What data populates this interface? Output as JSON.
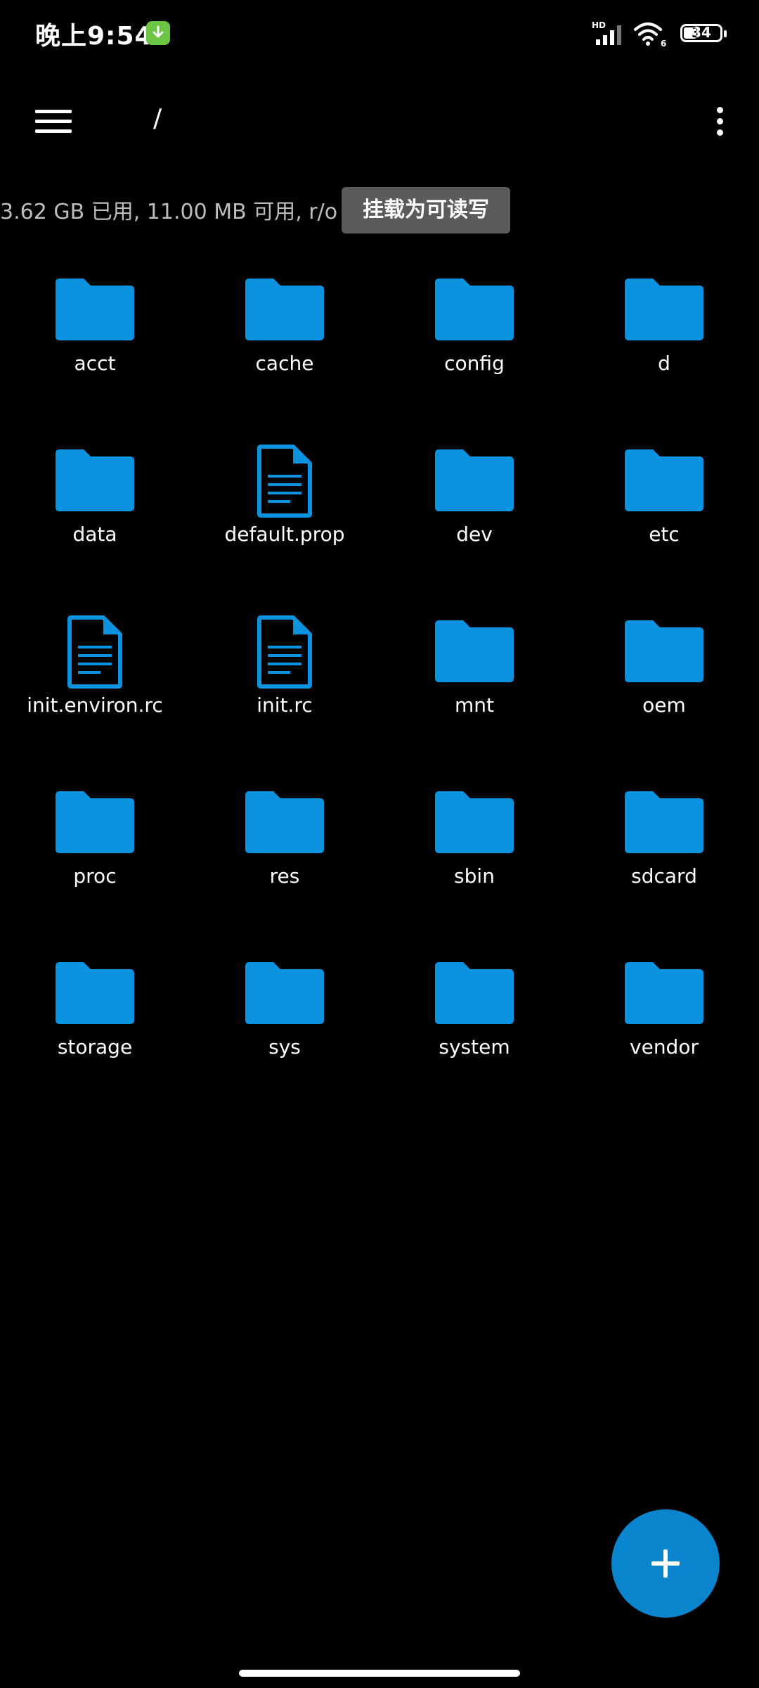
{
  "status_bar": {
    "time": "晚上9:54",
    "network": "HD",
    "wifi_badge": "6",
    "battery_level": "34",
    "icons": [
      "download-notification-icon",
      "signal-icon",
      "wifi-icon",
      "battery-icon"
    ]
  },
  "toolbar": {
    "path": "/",
    "icons": [
      "menu-icon",
      "more-options-icon"
    ]
  },
  "storage": {
    "info": "3.62 GB 已用, 11.00 MB 可用, r/o",
    "mount_button": "挂载为可读写"
  },
  "files": [
    {
      "name": "acct",
      "type": "folder"
    },
    {
      "name": "cache",
      "type": "folder"
    },
    {
      "name": "config",
      "type": "folder"
    },
    {
      "name": "d",
      "type": "folder"
    },
    {
      "name": "data",
      "type": "folder"
    },
    {
      "name": "default.prop",
      "type": "file"
    },
    {
      "name": "dev",
      "type": "folder"
    },
    {
      "name": "etc",
      "type": "folder"
    },
    {
      "name": "init.environ.rc",
      "type": "file"
    },
    {
      "name": "init.rc",
      "type": "file"
    },
    {
      "name": "mnt",
      "type": "folder"
    },
    {
      "name": "oem",
      "type": "folder"
    },
    {
      "name": "proc",
      "type": "folder"
    },
    {
      "name": "res",
      "type": "folder"
    },
    {
      "name": "sbin",
      "type": "folder"
    },
    {
      "name": "sdcard",
      "type": "folder"
    },
    {
      "name": "storage",
      "type": "folder"
    },
    {
      "name": "sys",
      "type": "folder"
    },
    {
      "name": "system",
      "type": "folder"
    },
    {
      "name": "vendor",
      "type": "folder"
    }
  ],
  "colors": {
    "background": "#000000",
    "folder": "#0b93e0",
    "fab": "#0a84cc",
    "mount_button_bg": "#5b5b5b"
  },
  "fab": {
    "icon": "plus-icon"
  }
}
